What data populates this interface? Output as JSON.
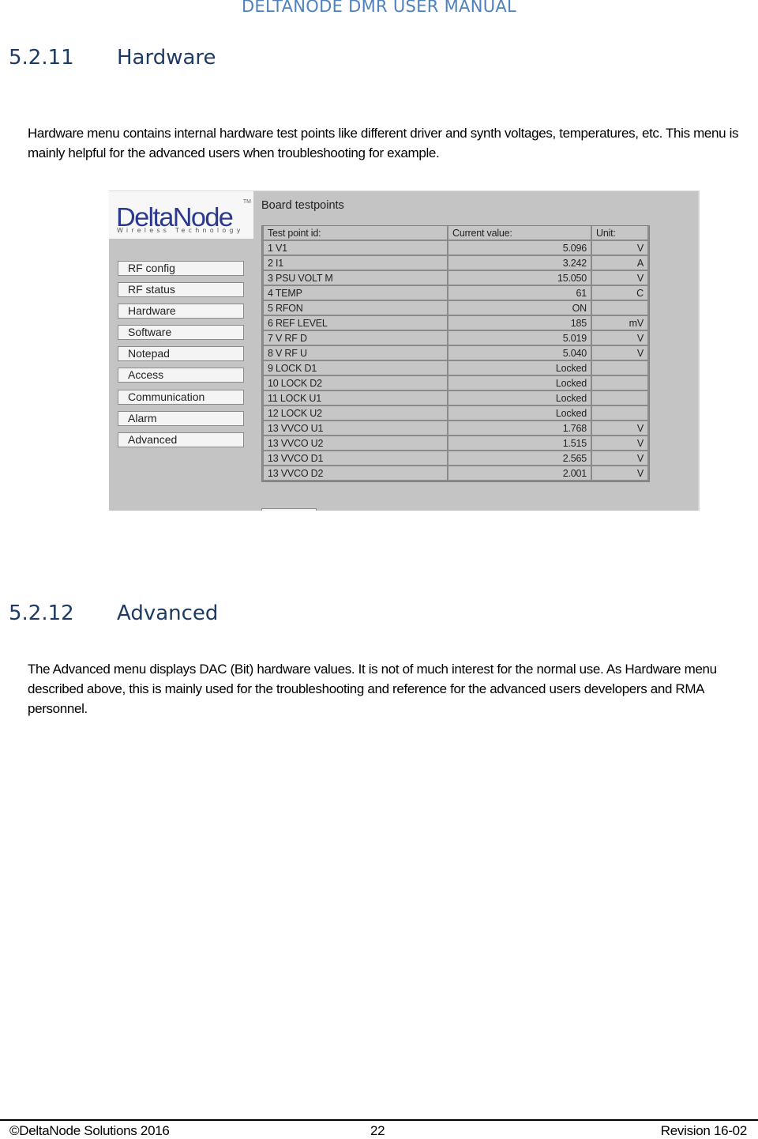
{
  "header": {
    "title": "DELTANODE DMR USER MANUAL"
  },
  "sections": [
    {
      "number": "5.2.11",
      "title": "Hardware",
      "body": "Hardware menu contains internal hardware test points like different driver and synth voltages, temperatures, etc. This menu is mainly helpful for the advanced users when troubleshooting for example."
    },
    {
      "number": "5.2.12",
      "title": "Advanced",
      "body": "The Advanced menu displays DAC (Bit) hardware values. It is not of much interest for the normal use. As Hardware menu described above, this is mainly used for the troubleshooting and reference for the advanced users developers and RMA personnel."
    }
  ],
  "screenshot": {
    "logo": {
      "brand": "DeltaNode",
      "tagline": "Wireless Technology",
      "tm": "TM"
    },
    "menu": [
      "RF config",
      "RF status",
      "Hardware",
      "Software",
      "Notepad",
      "Access",
      "Communication",
      "Alarm",
      "Advanced"
    ],
    "panel_title": "Board testpoints",
    "table": {
      "headers": {
        "id": "Test point id:",
        "value": "Current value:",
        "unit": "Unit:"
      },
      "rows": [
        {
          "id": "1 V1",
          "value": "5.096",
          "unit": "V"
        },
        {
          "id": "2 I1",
          "value": "3.242",
          "unit": "A"
        },
        {
          "id": "3 PSU VOLT M",
          "value": "15.050",
          "unit": "V"
        },
        {
          "id": "4 TEMP",
          "value": "61",
          "unit": "C"
        },
        {
          "id": "5 RFON",
          "value": "ON",
          "unit": ""
        },
        {
          "id": "6 REF LEVEL",
          "value": "185",
          "unit": "mV"
        },
        {
          "id": "7 V RF D",
          "value": "5.019",
          "unit": "V"
        },
        {
          "id": "8 V RF U",
          "value": "5.040",
          "unit": "V"
        },
        {
          "id": "9 LOCK D1",
          "value": "Locked",
          "unit": ""
        },
        {
          "id": "10 LOCK D2",
          "value": "Locked",
          "unit": ""
        },
        {
          "id": "11 LOCK U1",
          "value": "Locked",
          "unit": ""
        },
        {
          "id": "12 LOCK U2",
          "value": "Locked",
          "unit": ""
        },
        {
          "id": "13 VVCO U1",
          "value": "1.768",
          "unit": "V"
        },
        {
          "id": "13 VVCO U2",
          "value": "1.515",
          "unit": "V"
        },
        {
          "id": "13 VVCO D1",
          "value": "2.565",
          "unit": "V"
        },
        {
          "id": "13 VVCO D2",
          "value": "2.001",
          "unit": "V"
        }
      ]
    }
  },
  "footer": {
    "copyright": "©DeltaNode Solutions 2016",
    "page_number": "22",
    "revision": "Revision 16-02"
  }
}
